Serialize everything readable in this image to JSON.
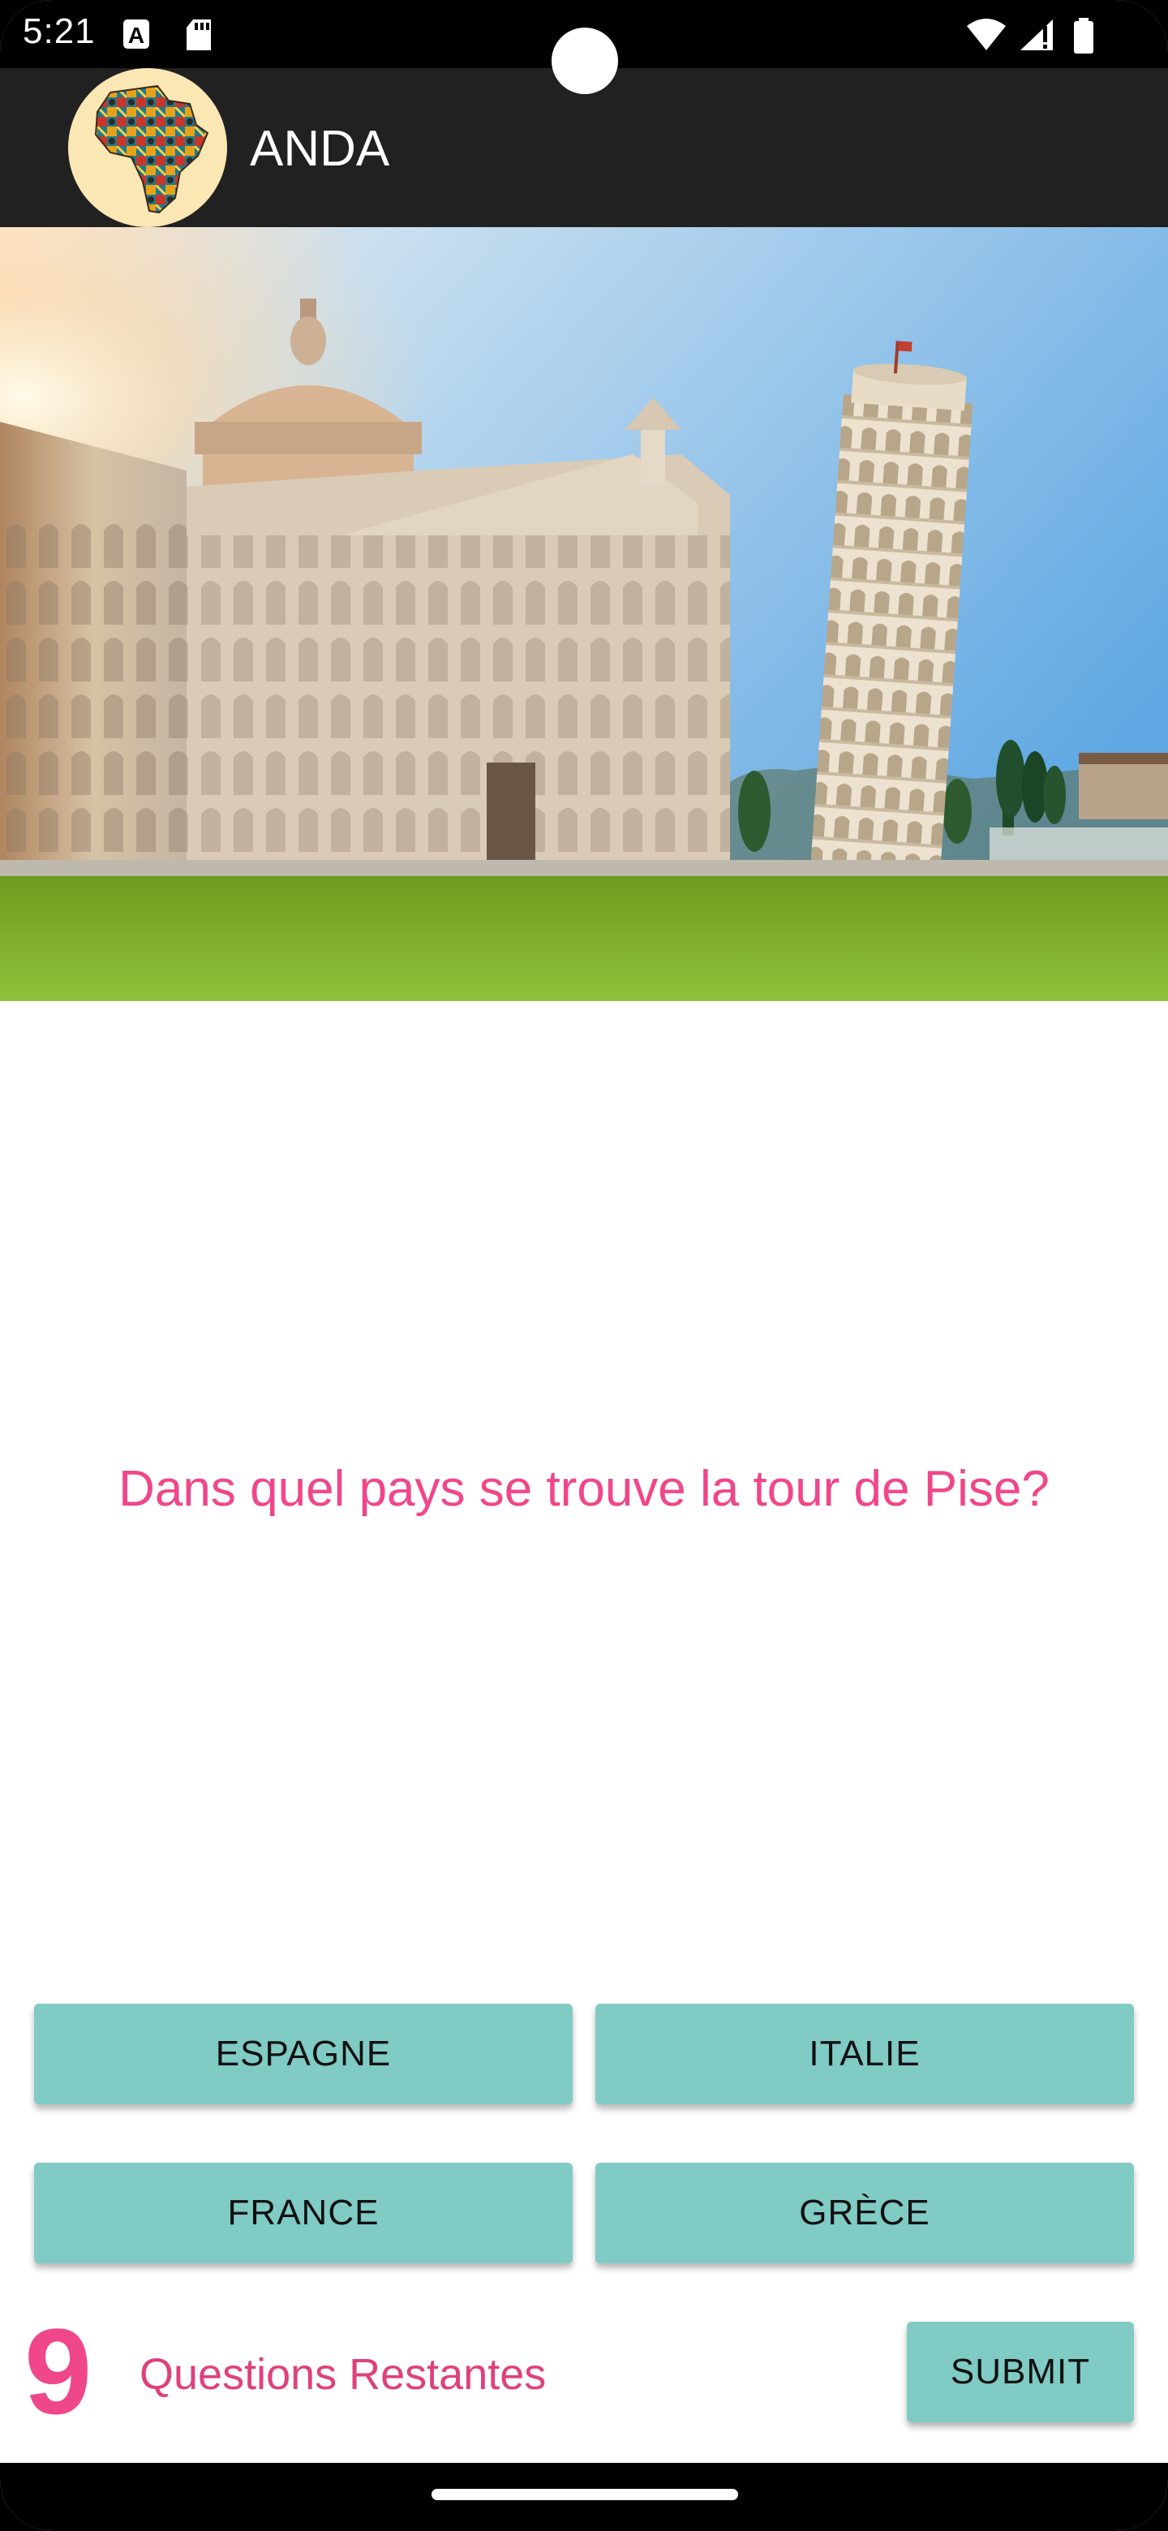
{
  "status_bar": {
    "time": "5:21"
  },
  "app_bar": {
    "title": "ANDA",
    "logo_icon": "africa-map-logo-icon"
  },
  "hero_image": {
    "icon": "pisa-cathedral-tower-photo"
  },
  "quiz": {
    "question": "Dans quel pays se trouve la tour de Pise?",
    "answers": [
      {
        "label": "ESPAGNE"
      },
      {
        "label": "ITALIE"
      },
      {
        "label": "FRANCE"
      },
      {
        "label": "GRÈCE"
      }
    ],
    "remaining_count": "9",
    "remaining_label": "Questions Restantes",
    "submit_label": "SUBMIT"
  },
  "colors": {
    "accent_pink": "#f0468a",
    "button_teal": "#80cbc4",
    "app_bar": "#212121"
  }
}
